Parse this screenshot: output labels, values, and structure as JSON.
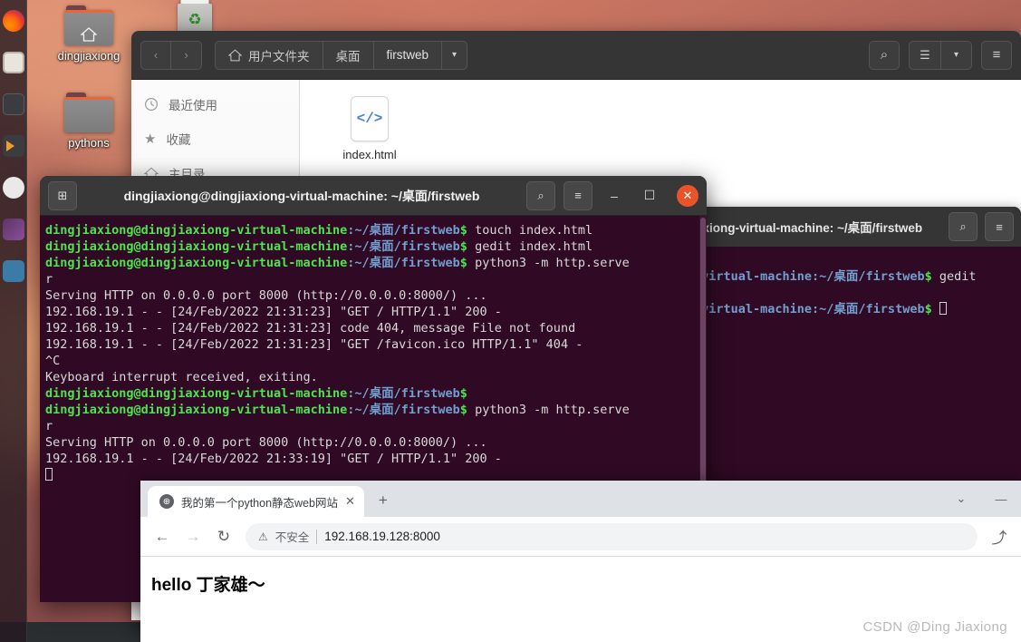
{
  "desktop": {
    "dock_items": [
      {
        "name": "firefox",
        "label": "Firefox"
      },
      {
        "name": "files",
        "label": "Files"
      },
      {
        "name": "terminal",
        "label": "Terminal"
      },
      {
        "name": "code-editor",
        "label": "Code"
      },
      {
        "name": "disc",
        "label": "Disc"
      },
      {
        "name": "software-store",
        "label": "Software"
      },
      {
        "name": "help",
        "label": "Help"
      }
    ],
    "icons": [
      {
        "label": "dingjiaxiong",
        "kind": "home-folder"
      },
      {
        "label": "pythons",
        "kind": "folder"
      },
      {
        "label": "",
        "kind": "trash"
      }
    ]
  },
  "file_manager": {
    "back_label": "‹",
    "forward_label": "›",
    "breadcrumbs": [
      {
        "label": "用户文件夹",
        "icon": "home-icon"
      },
      {
        "label": "桌面",
        "icon": ""
      },
      {
        "label": "firstweb",
        "icon": ""
      }
    ],
    "breadcrumb_dropdown": "▾",
    "search_label": "⌕",
    "view_list_label": "☰",
    "view_dropdown_label": "▾",
    "menu_label": "≡",
    "sidebar": [
      {
        "label": "最近使用",
        "icon": "clock-icon"
      },
      {
        "label": "收藏",
        "icon": "star-icon"
      },
      {
        "label": "主目录",
        "icon": "home-icon"
      }
    ],
    "files": [
      {
        "name": "index.html",
        "thumb_text": "</>",
        "type": "html-file"
      }
    ]
  },
  "terminal_main": {
    "title": "dingjiaxiong@dingjiaxiong-virtual-machine: ~/桌面/firstweb",
    "new_tab_label": "⊞",
    "search_label": "⌕",
    "menu_label": "≡",
    "minimize_label": "–",
    "maximize_label": "☐",
    "close_label": "✕",
    "prompt_user": "dingjiaxiong@dingjiaxiong-virtual-machine",
    "prompt_path": ":~/桌面/firstweb",
    "prompt_sigil": "$ ",
    "lines": [
      {
        "type": "prompt",
        "cmd": "touch index.html"
      },
      {
        "type": "prompt",
        "cmd": "gedit index.html"
      },
      {
        "type": "prompt",
        "cmd": "python3 -m http.serve"
      },
      {
        "type": "out",
        "text": "r"
      },
      {
        "type": "out",
        "text": "Serving HTTP on 0.0.0.0 port 8000 (http://0.0.0.0:8000/) ..."
      },
      {
        "type": "out",
        "text": "192.168.19.1 - - [24/Feb/2022 21:31:23] \"GET / HTTP/1.1\" 200 -"
      },
      {
        "type": "out",
        "text": "192.168.19.1 - - [24/Feb/2022 21:31:23] code 404, message File not found"
      },
      {
        "type": "out",
        "text": "192.168.19.1 - - [24/Feb/2022 21:31:23] \"GET /favicon.ico HTTP/1.1\" 404 -"
      },
      {
        "type": "out",
        "text": "^C"
      },
      {
        "type": "out",
        "text": "Keyboard interrupt received, exiting."
      },
      {
        "type": "prompt",
        "cmd": ""
      },
      {
        "type": "prompt",
        "cmd": "python3 -m http.serve"
      },
      {
        "type": "out",
        "text": "r"
      },
      {
        "type": "out",
        "text": "Serving HTTP on 0.0.0.0 port 8000 (http://0.0.0.0:8000/) ..."
      },
      {
        "type": "out",
        "text": "192.168.19.1 - - [24/Feb/2022 21:33:19] \"GET / HTTP/1.1\" 200 -"
      },
      {
        "type": "cursor",
        "text": ""
      }
    ]
  },
  "terminal_back": {
    "title": "axiong-virtual-machine: ~/桌面/firstweb",
    "search_label": "⌕",
    "menu_label": "≡",
    "lines": [
      {
        "type": "clipped_prompt",
        "path": "-virtual-machine:~/桌面/firstweb",
        "cmd": "gedit"
      },
      {
        "type": "clipped_prompt_cursor",
        "path": "-virtual-machine:~/桌面/firstweb",
        "cmd": ""
      }
    ]
  },
  "browser": {
    "tab_title": "我的第一个python静态web网站",
    "tab_favicon": "⊕",
    "tab_close": "✕",
    "new_tab": "+",
    "win_chevron": "⌄",
    "win_minimize": "—",
    "back": "←",
    "forward": "→",
    "reload": "↻",
    "security_icon": "⚠",
    "security_text": "不安全",
    "url": "192.168.19.128:8000",
    "share_icon": "⤴",
    "page_heading": "hello 丁家雄～"
  },
  "watermark": "CSDN @Ding Jiaxiong",
  "colors": {
    "terminal_bg": "#300a24",
    "prompt_green": "#4ee44e",
    "prompt_blue": "#729fcf",
    "terminal_fg": "#d8d8d8",
    "headerbar": "#353535",
    "close_red": "#e9542b",
    "chrome_tabstrip": "#dee1e6",
    "omnibox_bg": "#f1f3f4",
    "html_icon_blue": "#4a7fe0"
  }
}
